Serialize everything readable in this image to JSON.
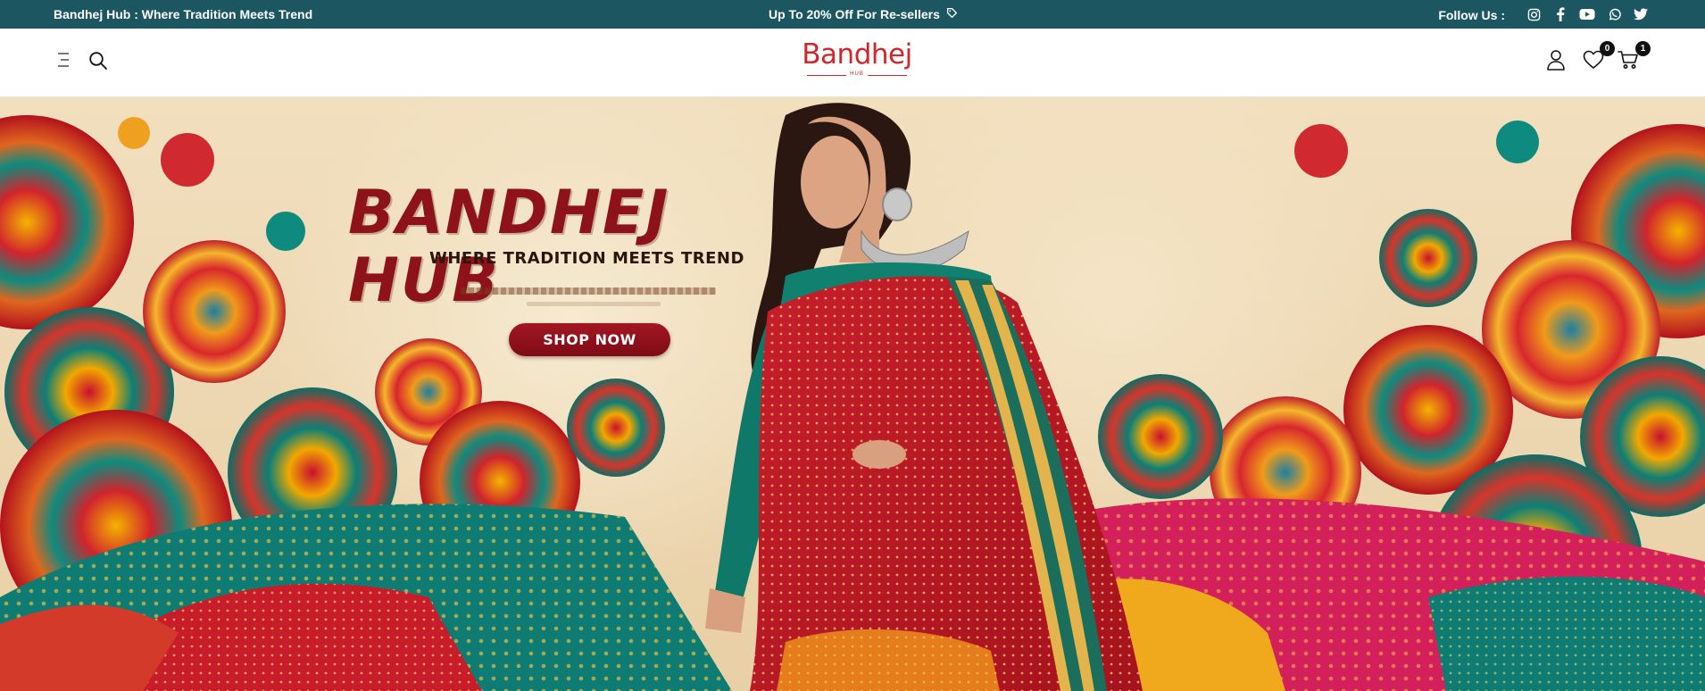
{
  "announcement": {
    "brand_tagline": "Bandhej Hub : Where Tradition Meets Trend",
    "offer": "Up To 20% Off For Re-sellers",
    "offer_icon": "tag-icon",
    "follow_label": "Follow Us :",
    "social_icons": [
      "instagram-icon",
      "facebook-icon",
      "youtube-icon",
      "whatsapp-icon",
      "twitter-icon"
    ]
  },
  "header": {
    "logo_text": "Bandhej",
    "logo_subtext": "HUB",
    "icons": [
      "menu-icon",
      "search-icon",
      "user-icon",
      "heart-icon",
      "cart-icon"
    ],
    "wishlist_count": "0",
    "cart_count": "1"
  },
  "hero": {
    "title": "BANDHEJ HUB",
    "tagline": "WHERE TRADITION MEETS TREND",
    "button_label": "SHOP NOW"
  },
  "colors": {
    "topbar_bg": "#1c5661",
    "brand_red": "#d0262c",
    "hero_title": "#8e1219",
    "button_bg": "#8e1219"
  }
}
